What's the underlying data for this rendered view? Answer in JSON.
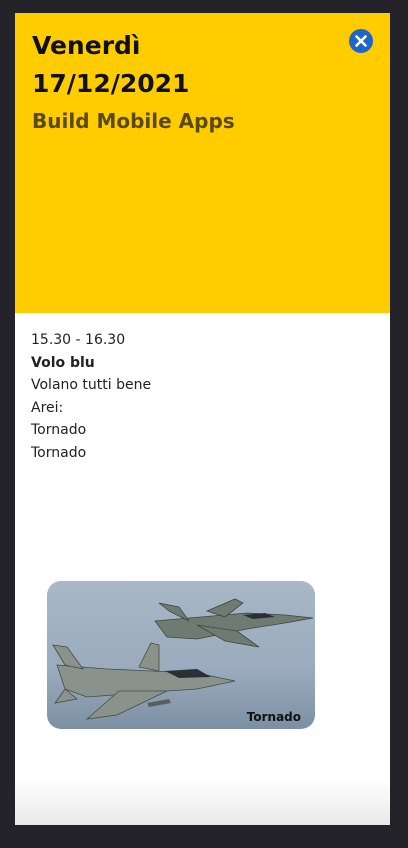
{
  "header": {
    "day": "Venerdì",
    "date": "17/12/2021",
    "subtitle": "Build Mobile Apps",
    "background_color": "#ffcc00",
    "close_icon": "close-icon",
    "close_color": "#1f66c8"
  },
  "event": {
    "time": "15.30 - 16.30",
    "title": "Volo blu",
    "description": "Volano tutti bene",
    "aircraft_label": "Arei:",
    "aircraft": [
      "Tornado",
      "Tornado"
    ]
  },
  "photo": {
    "caption": "Tornado",
    "subject": "two Tornado jet aircraft in flight"
  }
}
